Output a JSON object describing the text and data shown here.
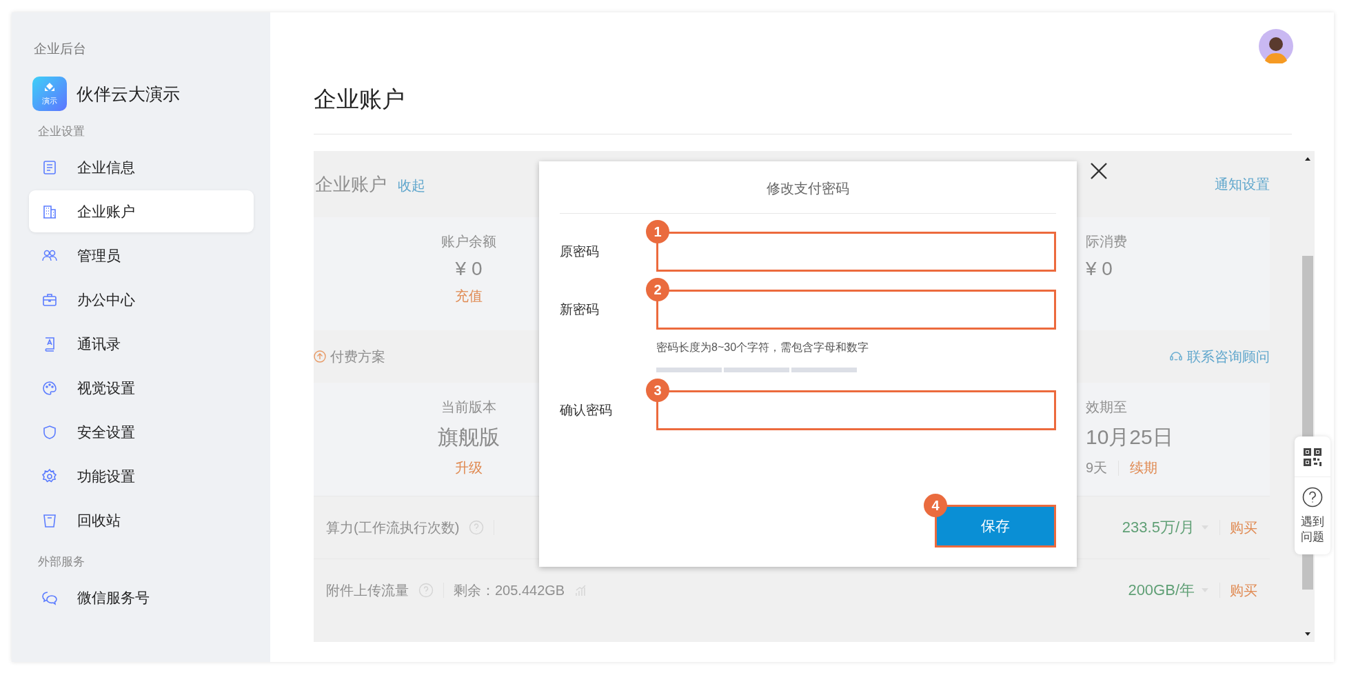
{
  "sidebar": {
    "header": "企业后台",
    "brand": {
      "name": "伙伴云大演示",
      "logo_text": "演示"
    },
    "sections": [
      {
        "title": "企业设置",
        "items": [
          {
            "label": "企业信息",
            "selected": false
          },
          {
            "label": "企业账户",
            "selected": true
          },
          {
            "label": "管理员",
            "selected": false
          },
          {
            "label": "办公中心",
            "selected": false
          },
          {
            "label": "通讯录",
            "selected": false
          },
          {
            "label": "视觉设置",
            "selected": false
          },
          {
            "label": "安全设置",
            "selected": false
          },
          {
            "label": "功能设置",
            "selected": false
          },
          {
            "label": "回收站",
            "selected": false
          }
        ]
      },
      {
        "title": "外部服务",
        "items": [
          {
            "label": "微信服务号",
            "selected": false
          }
        ]
      }
    ]
  },
  "page": {
    "title": "企业账户"
  },
  "account_panel": {
    "title": "企业账户",
    "collapse_link": "收起",
    "notify_link": "通知设置",
    "balance": {
      "label": "账户余额",
      "value": "¥ 0",
      "action": "充值"
    },
    "spent": {
      "label": "际消费",
      "value": "¥ 0"
    },
    "plan_link": "付费方案",
    "consult_link": "联系咨询顾问",
    "version": {
      "label": "当前版本",
      "value": "旗舰版",
      "action": "升级"
    },
    "expiry": {
      "label": "效期至",
      "value": "10月25日",
      "remaining": "9天",
      "action": "续期"
    },
    "quotas": [
      {
        "label": "算力(工作流执行次数)",
        "plan": "233.5万/月",
        "action": "购买"
      },
      {
        "label": "附件上传流量",
        "remaining": "剩余：205.442GB",
        "plan": "200GB/年",
        "action": "购买"
      }
    ]
  },
  "dialog": {
    "title": "修改支付密码",
    "fields": [
      {
        "label": "原密码",
        "badge": "1",
        "highlighted": true
      },
      {
        "label": "新密码",
        "badge": "2",
        "highlighted": true,
        "hint": "密码长度为8~30个字符，需包含字母和数字"
      },
      {
        "label": "确认密码",
        "badge": "3",
        "highlighted": true
      }
    ],
    "save_button": {
      "label": "保存",
      "badge": "4",
      "highlighted": true
    }
  },
  "help_widget": {
    "label": "遇到问题"
  }
}
